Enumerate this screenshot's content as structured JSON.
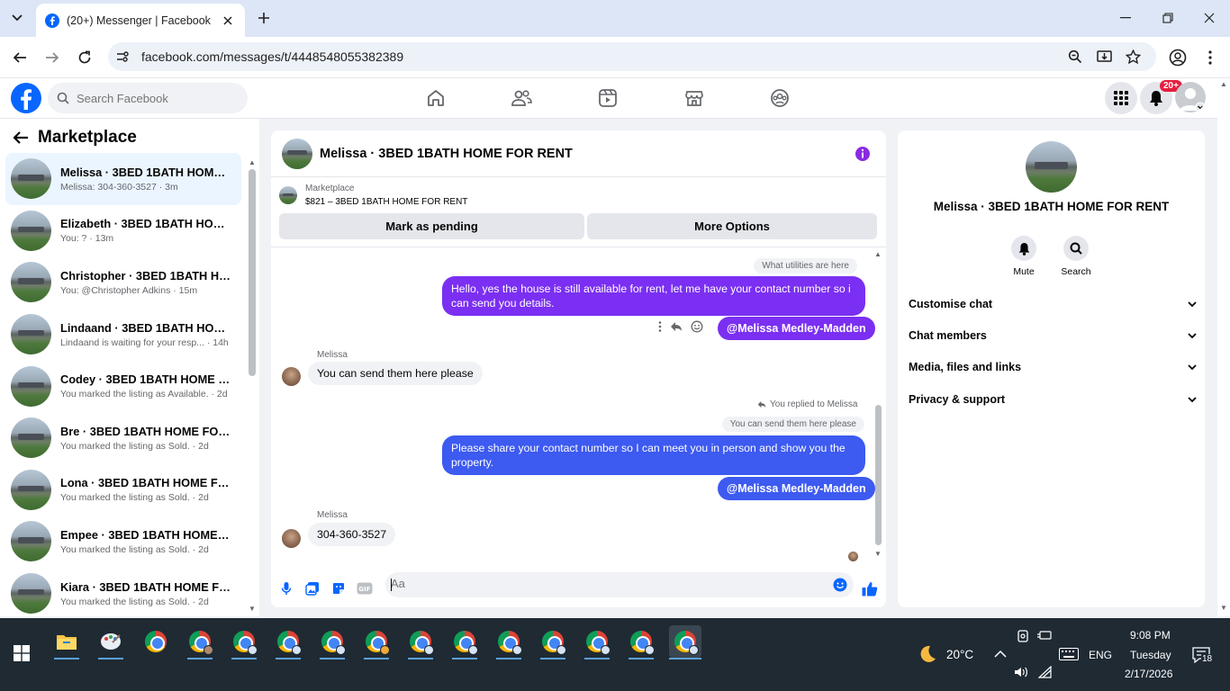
{
  "browser": {
    "tab_title": "(20+) Messenger | Facebook",
    "url": "facebook.com/messages/t/4448548055382389"
  },
  "fb": {
    "search_placeholder": "Search Facebook",
    "notification_badge": "20+"
  },
  "sidebar": {
    "title": "Marketplace",
    "conversations": [
      {
        "name": "Melissa · 3BED 1BATH HOME FO...",
        "sub": "Melissa: 304-360-3527 · 3m",
        "active": true
      },
      {
        "name": "Elizabeth · 3BED 1BATH HOME F...",
        "sub": "You: ? · 13m"
      },
      {
        "name": "Christopher · 3BED 1BATH HOM...",
        "sub": "You: @Christopher Adkins · 15m"
      },
      {
        "name": "Lindaand · 3BED 1BATH HOME ...",
        "sub": "Lindaand is waiting for your resp... · 14h"
      },
      {
        "name": "Codey · 3BED 1BATH HOME FO...",
        "sub": "You marked the listing as Available. · 2d"
      },
      {
        "name": "Bre · 3BED 1BATH HOME FOR R...",
        "sub": "You marked the listing as Sold. · 2d"
      },
      {
        "name": "Lona · 3BED 1BATH HOME FOR ...",
        "sub": "You marked the listing as Sold. · 2d"
      },
      {
        "name": "Empee · 3BED 1BATH HOME FO...",
        "sub": "You marked the listing as Sold. · 2d"
      },
      {
        "name": "Kiara · 3BED 1BATH HOME FOR ...",
        "sub": "You marked the listing as Sold. · 2d"
      }
    ]
  },
  "chat": {
    "title": "Melissa · 3BED 1BATH HOME FOR RENT",
    "marketplace_label": "Marketplace",
    "listing": "$821 – 3BED 1BATH HOME FOR RENT",
    "mark_pending": "Mark as pending",
    "more_options": "More Options",
    "quote1": "What utilities are here",
    "msg1": "Hello, yes the house is still available for rent, let me have your contact number so i can send you details.",
    "mention1": "@Melissa Medley-Madden",
    "sender1": "Melissa",
    "in1": "You can send them here please",
    "replied_note": "You replied to Melissa",
    "quote2": "You can send them here please",
    "msg2": "Please share your contact number so I can meet you in person and show you the property.",
    "mention2": "@Melissa Medley-Madden",
    "sender2": "Melissa",
    "in2": "304-360-3527",
    "composer_placeholder": "Aa",
    "colors": {
      "purple": "#7b2ff2",
      "blue": "#3d5af1",
      "accent": "#0866ff"
    }
  },
  "info": {
    "name": "Melissa · 3BED 1BATH HOME FOR RENT",
    "mute": "Mute",
    "search": "Search",
    "sections": [
      "Customise chat",
      "Chat members",
      "Media, files and links",
      "Privacy & support"
    ]
  },
  "taskbar": {
    "weather": "20°C",
    "lang": "ENG",
    "time": "9:08 PM",
    "day": "Tuesday",
    "date": "2/17/2026",
    "notif_count": "18"
  }
}
